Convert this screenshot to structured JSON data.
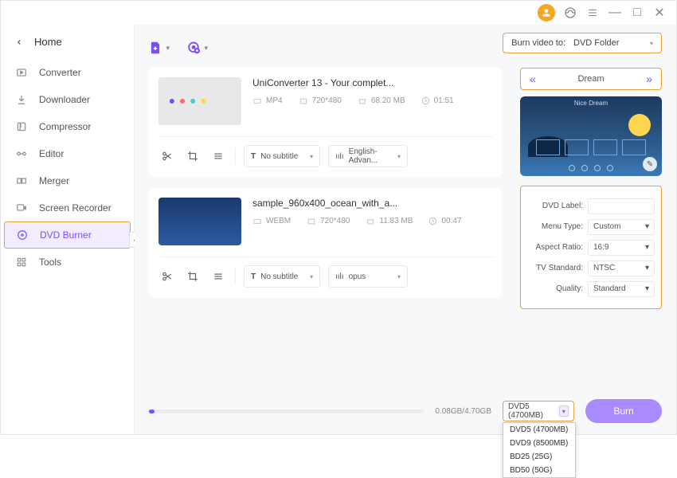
{
  "titlebar": {
    "minimize": "—",
    "maximize": "□",
    "close": "✕"
  },
  "sidebar": {
    "home": "Home",
    "items": [
      {
        "icon": "converter",
        "label": "Converter"
      },
      {
        "icon": "downloader",
        "label": "Downloader"
      },
      {
        "icon": "compressor",
        "label": "Compressor"
      },
      {
        "icon": "editor",
        "label": "Editor"
      },
      {
        "icon": "merger",
        "label": "Merger"
      },
      {
        "icon": "screen-recorder",
        "label": "Screen Recorder"
      },
      {
        "icon": "dvd-burner",
        "label": "DVD Burner"
      },
      {
        "icon": "tools",
        "label": "Tools"
      }
    ]
  },
  "burn_to": {
    "label": "Burn video to:",
    "value": "DVD Folder"
  },
  "files": [
    {
      "name": "UniConverter 13 - Your complet...",
      "format": "MP4",
      "resolution": "720*480",
      "size": "68.20 MB",
      "duration": "01:51",
      "subtitle": "No subtitle",
      "audio": "English-Advan..."
    },
    {
      "name": "sample_960x400_ocean_with_a...",
      "format": "WEBM",
      "resolution": "720*480",
      "size": "11.83 MB",
      "duration": "00:47",
      "subtitle": "No subtitle",
      "audio": "opus"
    }
  ],
  "theme": {
    "name": "Dream",
    "preview_title": "Nice Dream"
  },
  "settings": {
    "labels": {
      "dvd_label": "DVD Label:",
      "menu_type": "Menu Type:",
      "aspect": "Aspect Ratio:",
      "tv": "TV Standard:",
      "quality": "Quality:"
    },
    "dvd_label": "",
    "menu_type": "Custom",
    "aspect_ratio": "16:9",
    "tv_standard": "NTSC",
    "quality": "Standard"
  },
  "footer": {
    "progress_text": "0.08GB/4.70GB",
    "disc_selected": "DVD5 (4700MB)",
    "disc_options": [
      "DVD5 (4700MB)",
      "DVD9 (8500MB)",
      "BD25 (25G)",
      "BD50 (50G)"
    ],
    "burn_label": "Burn"
  }
}
